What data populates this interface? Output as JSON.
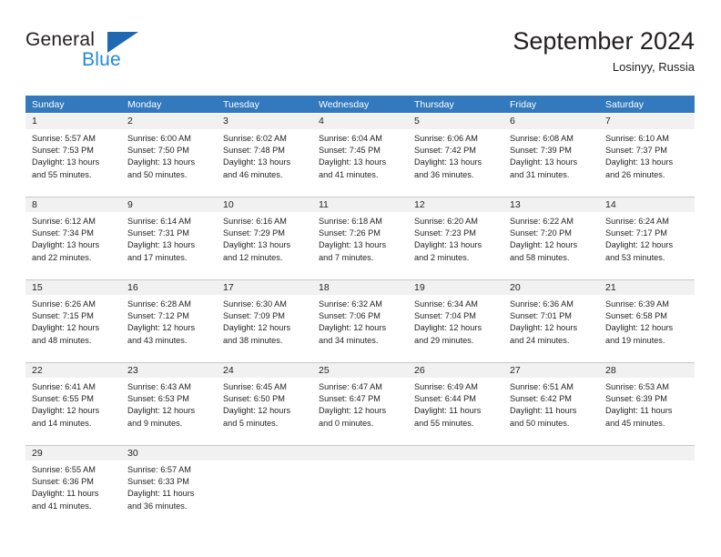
{
  "brand": {
    "name_part1": "General",
    "name_part2": "Blue",
    "triangle_color": "#1f69b3",
    "blue_text_color": "#2288dd"
  },
  "header": {
    "title": "September 2024",
    "subtitle": "Losinyy, Russia"
  },
  "theme": {
    "header_row_bg": "#3279bd",
    "header_row_text": "#ffffff",
    "daynum_band_bg": "#f1f1f1",
    "grid_line": "#c8c8c8",
    "body_text": "#231f20"
  },
  "weekdays": [
    "Sunday",
    "Monday",
    "Tuesday",
    "Wednesday",
    "Thursday",
    "Friday",
    "Saturday"
  ],
  "weeks": [
    {
      "days": [
        {
          "num": "1",
          "sunrise": "Sunrise: 5:57 AM",
          "sunset": "Sunset: 7:53 PM",
          "daylight1": "Daylight: 13 hours",
          "daylight2": "and 55 minutes."
        },
        {
          "num": "2",
          "sunrise": "Sunrise: 6:00 AM",
          "sunset": "Sunset: 7:50 PM",
          "daylight1": "Daylight: 13 hours",
          "daylight2": "and 50 minutes."
        },
        {
          "num": "3",
          "sunrise": "Sunrise: 6:02 AM",
          "sunset": "Sunset: 7:48 PM",
          "daylight1": "Daylight: 13 hours",
          "daylight2": "and 46 minutes."
        },
        {
          "num": "4",
          "sunrise": "Sunrise: 6:04 AM",
          "sunset": "Sunset: 7:45 PM",
          "daylight1": "Daylight: 13 hours",
          "daylight2": "and 41 minutes."
        },
        {
          "num": "5",
          "sunrise": "Sunrise: 6:06 AM",
          "sunset": "Sunset: 7:42 PM",
          "daylight1": "Daylight: 13 hours",
          "daylight2": "and 36 minutes."
        },
        {
          "num": "6",
          "sunrise": "Sunrise: 6:08 AM",
          "sunset": "Sunset: 7:39 PM",
          "daylight1": "Daylight: 13 hours",
          "daylight2": "and 31 minutes."
        },
        {
          "num": "7",
          "sunrise": "Sunrise: 6:10 AM",
          "sunset": "Sunset: 7:37 PM",
          "daylight1": "Daylight: 13 hours",
          "daylight2": "and 26 minutes."
        }
      ]
    },
    {
      "days": [
        {
          "num": "8",
          "sunrise": "Sunrise: 6:12 AM",
          "sunset": "Sunset: 7:34 PM",
          "daylight1": "Daylight: 13 hours",
          "daylight2": "and 22 minutes."
        },
        {
          "num": "9",
          "sunrise": "Sunrise: 6:14 AM",
          "sunset": "Sunset: 7:31 PM",
          "daylight1": "Daylight: 13 hours",
          "daylight2": "and 17 minutes."
        },
        {
          "num": "10",
          "sunrise": "Sunrise: 6:16 AM",
          "sunset": "Sunset: 7:29 PM",
          "daylight1": "Daylight: 13 hours",
          "daylight2": "and 12 minutes."
        },
        {
          "num": "11",
          "sunrise": "Sunrise: 6:18 AM",
          "sunset": "Sunset: 7:26 PM",
          "daylight1": "Daylight: 13 hours",
          "daylight2": "and 7 minutes."
        },
        {
          "num": "12",
          "sunrise": "Sunrise: 6:20 AM",
          "sunset": "Sunset: 7:23 PM",
          "daylight1": "Daylight: 13 hours",
          "daylight2": "and 2 minutes."
        },
        {
          "num": "13",
          "sunrise": "Sunrise: 6:22 AM",
          "sunset": "Sunset: 7:20 PM",
          "daylight1": "Daylight: 12 hours",
          "daylight2": "and 58 minutes."
        },
        {
          "num": "14",
          "sunrise": "Sunrise: 6:24 AM",
          "sunset": "Sunset: 7:17 PM",
          "daylight1": "Daylight: 12 hours",
          "daylight2": "and 53 minutes."
        }
      ]
    },
    {
      "days": [
        {
          "num": "15",
          "sunrise": "Sunrise: 6:26 AM",
          "sunset": "Sunset: 7:15 PM",
          "daylight1": "Daylight: 12 hours",
          "daylight2": "and 48 minutes."
        },
        {
          "num": "16",
          "sunrise": "Sunrise: 6:28 AM",
          "sunset": "Sunset: 7:12 PM",
          "daylight1": "Daylight: 12 hours",
          "daylight2": "and 43 minutes."
        },
        {
          "num": "17",
          "sunrise": "Sunrise: 6:30 AM",
          "sunset": "Sunset: 7:09 PM",
          "daylight1": "Daylight: 12 hours",
          "daylight2": "and 38 minutes."
        },
        {
          "num": "18",
          "sunrise": "Sunrise: 6:32 AM",
          "sunset": "Sunset: 7:06 PM",
          "daylight1": "Daylight: 12 hours",
          "daylight2": "and 34 minutes."
        },
        {
          "num": "19",
          "sunrise": "Sunrise: 6:34 AM",
          "sunset": "Sunset: 7:04 PM",
          "daylight1": "Daylight: 12 hours",
          "daylight2": "and 29 minutes."
        },
        {
          "num": "20",
          "sunrise": "Sunrise: 6:36 AM",
          "sunset": "Sunset: 7:01 PM",
          "daylight1": "Daylight: 12 hours",
          "daylight2": "and 24 minutes."
        },
        {
          "num": "21",
          "sunrise": "Sunrise: 6:39 AM",
          "sunset": "Sunset: 6:58 PM",
          "daylight1": "Daylight: 12 hours",
          "daylight2": "and 19 minutes."
        }
      ]
    },
    {
      "days": [
        {
          "num": "22",
          "sunrise": "Sunrise: 6:41 AM",
          "sunset": "Sunset: 6:55 PM",
          "daylight1": "Daylight: 12 hours",
          "daylight2": "and 14 minutes."
        },
        {
          "num": "23",
          "sunrise": "Sunrise: 6:43 AM",
          "sunset": "Sunset: 6:53 PM",
          "daylight1": "Daylight: 12 hours",
          "daylight2": "and 9 minutes."
        },
        {
          "num": "24",
          "sunrise": "Sunrise: 6:45 AM",
          "sunset": "Sunset: 6:50 PM",
          "daylight1": "Daylight: 12 hours",
          "daylight2": "and 5 minutes."
        },
        {
          "num": "25",
          "sunrise": "Sunrise: 6:47 AM",
          "sunset": "Sunset: 6:47 PM",
          "daylight1": "Daylight: 12 hours",
          "daylight2": "and 0 minutes."
        },
        {
          "num": "26",
          "sunrise": "Sunrise: 6:49 AM",
          "sunset": "Sunset: 6:44 PM",
          "daylight1": "Daylight: 11 hours",
          "daylight2": "and 55 minutes."
        },
        {
          "num": "27",
          "sunrise": "Sunrise: 6:51 AM",
          "sunset": "Sunset: 6:42 PM",
          "daylight1": "Daylight: 11 hours",
          "daylight2": "and 50 minutes."
        },
        {
          "num": "28",
          "sunrise": "Sunrise: 6:53 AM",
          "sunset": "Sunset: 6:39 PM",
          "daylight1": "Daylight: 11 hours",
          "daylight2": "and 45 minutes."
        }
      ]
    },
    {
      "days": [
        {
          "num": "29",
          "sunrise": "Sunrise: 6:55 AM",
          "sunset": "Sunset: 6:36 PM",
          "daylight1": "Daylight: 11 hours",
          "daylight2": "and 41 minutes."
        },
        {
          "num": "30",
          "sunrise": "Sunrise: 6:57 AM",
          "sunset": "Sunset: 6:33 PM",
          "daylight1": "Daylight: 11 hours",
          "daylight2": "and 36 minutes."
        },
        {
          "num": "",
          "sunrise": "",
          "sunset": "",
          "daylight1": "",
          "daylight2": ""
        },
        {
          "num": "",
          "sunrise": "",
          "sunset": "",
          "daylight1": "",
          "daylight2": ""
        },
        {
          "num": "",
          "sunrise": "",
          "sunset": "",
          "daylight1": "",
          "daylight2": ""
        },
        {
          "num": "",
          "sunrise": "",
          "sunset": "",
          "daylight1": "",
          "daylight2": ""
        },
        {
          "num": "",
          "sunrise": "",
          "sunset": "",
          "daylight1": "",
          "daylight2": ""
        }
      ]
    }
  ]
}
